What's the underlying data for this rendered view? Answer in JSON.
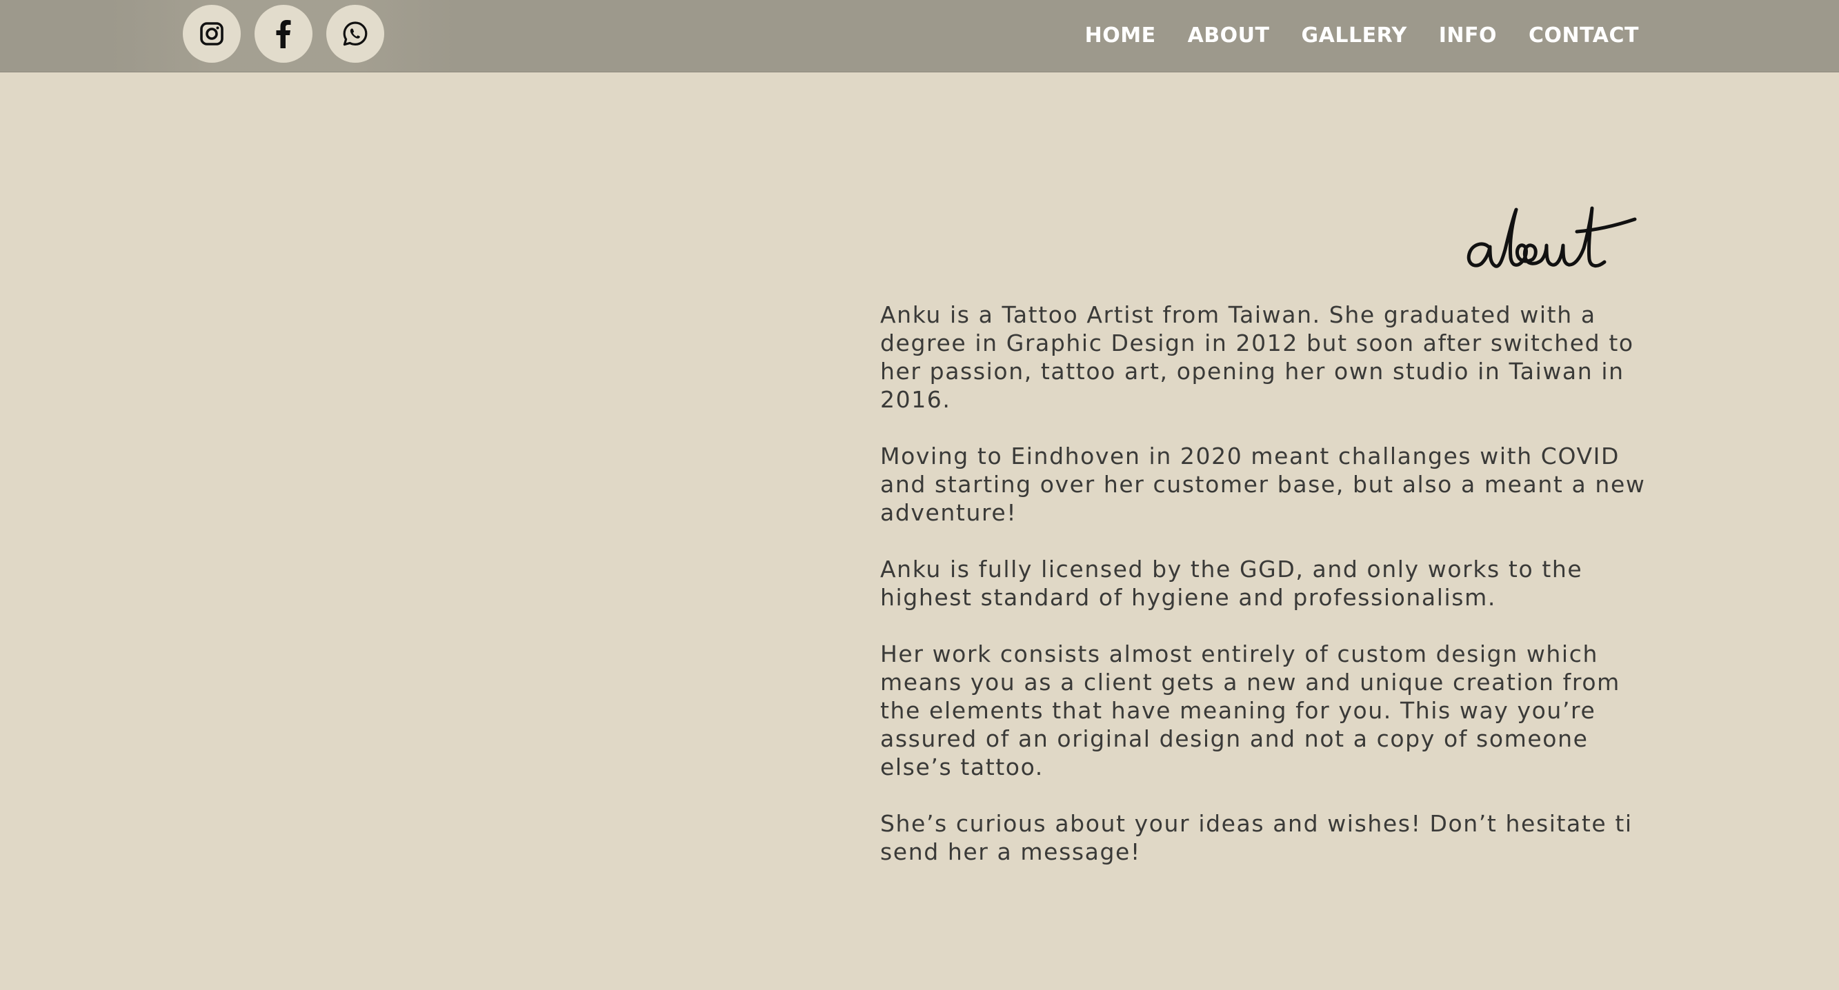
{
  "social": [
    {
      "name": "instagram-icon"
    },
    {
      "name": "facebook-icon"
    },
    {
      "name": "whatsapp-icon"
    }
  ],
  "nav": {
    "items": [
      {
        "label": "HOME"
      },
      {
        "label": "ABOUT"
      },
      {
        "label": "GALLERY"
      },
      {
        "label": "INFO"
      },
      {
        "label": "CONTACT"
      }
    ]
  },
  "about": {
    "heading": "about",
    "paragraphs": [
      "Anku is a Tattoo Artist from Taiwan. She graduated with a degree in Graphic Design in 2012 but soon after switched to her passion, tattoo art, opening her own studio in Taiwan in 2016.",
      "Moving to Eindhoven in 2020 meant challanges with COVID and starting over her customer base, but also a meant a new adventure!",
      "Anku is fully licensed by the GGD, and only works to the highest standard of hygiene and professionalism.",
      "Her work consists almost entirely of custom design which means you as a client gets a new and unique creation from the elements that have meaning for you. This way you’re assured of an original design and not a copy of someone else’s tattoo.",
      "She’s curious about your ideas and wishes! Don’t hesitate ti send her a message!"
    ]
  },
  "colors": {
    "header_bg": "#9d998c",
    "page_bg": "#e0d8c6",
    "social_bg": "#e2dccc",
    "nav_text": "#ffffff",
    "body_text": "#3a3a38"
  }
}
